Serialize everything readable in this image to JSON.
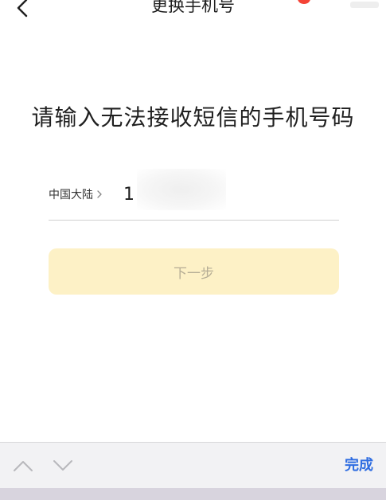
{
  "nav": {
    "title": "更换手机号",
    "back_icon": "chevron-left-icon"
  },
  "main": {
    "heading": "请输入无法接收短信的手机号码",
    "phone": {
      "region_label": "中国大陆",
      "region_chevron": "chevron-right-icon",
      "value": "1"
    },
    "next_button_label": "下一步"
  },
  "toolbar": {
    "prev_icon": "chevron-up-icon",
    "next_icon": "chevron-down-icon",
    "done_label": "完成"
  },
  "colors": {
    "accent": "#2f6de1",
    "button_disabled_bg": "#fdf1c6",
    "button_disabled_text": "#b5ad95",
    "badge": "#f44336"
  }
}
